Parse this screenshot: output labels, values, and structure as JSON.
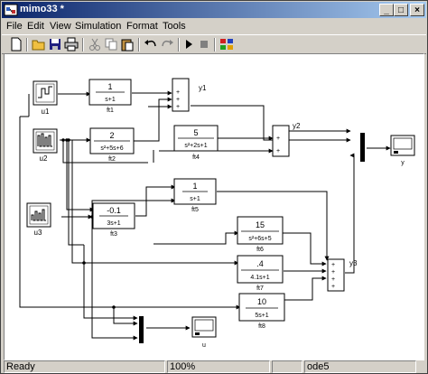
{
  "window": {
    "title": "mimo33 *",
    "title_icon": "simulink-model-icon",
    "controls": {
      "minimize": "_",
      "maximize": "□",
      "close": "×"
    }
  },
  "menu": [
    "File",
    "Edit",
    "View",
    "Simulation",
    "Format",
    "Tools"
  ],
  "toolbar": {
    "buttons": [
      "new-model",
      "open",
      "save",
      "print",
      "cut",
      "copy",
      "paste",
      "undo",
      "redo",
      "start-simulation",
      "stop-simulation",
      "library-browser"
    ]
  },
  "blocks": {
    "u1": {
      "label": "u1"
    },
    "u2": {
      "label": "u2"
    },
    "u3": {
      "label": "u3"
    },
    "ft1": {
      "num": "1",
      "den": "s+1",
      "label": "ft1"
    },
    "ft2": {
      "num": "2",
      "den": "s²+5s+6",
      "label": "ft2"
    },
    "ft3": {
      "num": "-0.1",
      "den": "3s+1",
      "label": "ft3"
    },
    "ft4": {
      "num": "5",
      "den": "s²+2s+1",
      "label": "ft4"
    },
    "ft5": {
      "num": "1",
      "den": "s+1",
      "label": "ft5"
    },
    "ft6": {
      "num": "15",
      "den": "s²+6s+5",
      "label": "ft6"
    },
    "ft7": {
      "num": ".4",
      "den": "4.1s+1",
      "label": "ft7"
    },
    "ft8": {
      "num": "10",
      "den": "5s+1",
      "label": "ft8"
    },
    "sum1": {
      "label": "y1",
      "signs": [
        "+",
        "+",
        "+"
      ]
    },
    "sum2": {
      "label": "y2",
      "signs": [
        "+",
        "+"
      ]
    },
    "sum3": {
      "label": "y3",
      "signs": [
        "+",
        "+",
        "+",
        "+"
      ]
    },
    "scope_y": {
      "label": "y"
    },
    "scope_u": {
      "label": "u"
    }
  },
  "status": {
    "state": "Ready",
    "zoom": "100%",
    "solver": "ode5"
  }
}
